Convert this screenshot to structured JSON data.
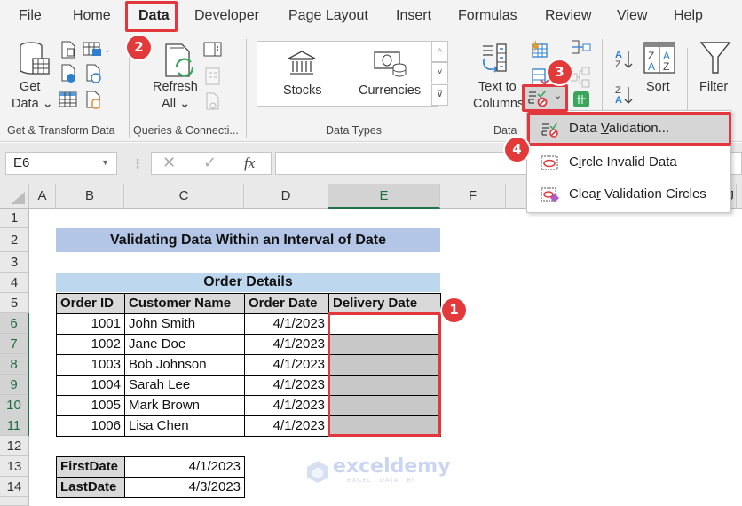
{
  "tabs": [
    {
      "label": "File",
      "active": false
    },
    {
      "label": "Home",
      "active": false
    },
    {
      "label": "Data",
      "active": true
    },
    {
      "label": "Developer",
      "active": false
    },
    {
      "label": "Page Layout",
      "active": false
    },
    {
      "label": "Insert",
      "active": false
    },
    {
      "label": "Formulas",
      "active": false
    },
    {
      "label": "Review",
      "active": false
    },
    {
      "label": "View",
      "active": false
    },
    {
      "label": "Help",
      "active": false
    }
  ],
  "ribbon": {
    "get_data": {
      "line1": "Get",
      "line2": "Data ⌄"
    },
    "refresh_all": {
      "line1": "Refresh",
      "line2": "All ⌄"
    },
    "stocks": "Stocks",
    "currencies": "Currencies",
    "text_to_columns": {
      "line1": "Text to",
      "line2": "Columns"
    },
    "sort": "Sort",
    "filter": "Filter",
    "groups": {
      "get_transform": "Get & Transform Data",
      "queries": "Queries & Connecti...",
      "data_types": "Data Types",
      "data_tools": "Data"
    }
  },
  "dropdown": {
    "items": [
      {
        "pre": "Data ",
        "u": "V",
        "post": "alidation...",
        "highlighted": true
      },
      {
        "pre": "C",
        "u": "i",
        "post": "rcle Invalid Data",
        "highlighted": false
      },
      {
        "pre": "Clea",
        "u": "r",
        "post": " Validation Circles",
        "highlighted": false
      }
    ]
  },
  "formula_bar": {
    "name_box": "E6",
    "fx": "fx",
    "value": ""
  },
  "columns": [
    "A",
    "B",
    "C",
    "D",
    "E",
    "F",
    "J"
  ],
  "rows": [
    "1",
    "2",
    "3",
    "4",
    "5",
    "6",
    "7",
    "8",
    "9",
    "10",
    "11",
    "12",
    "13",
    "14"
  ],
  "sheet": {
    "title": "Validating Data Within an Interval of Date",
    "table_title": "Order Details",
    "headers": [
      "Order ID",
      "Customer Name",
      "Order Date",
      "Delivery Date"
    ],
    "rows": [
      {
        "id": "1001",
        "name": "John Smith",
        "order_date": "4/1/2023",
        "delivery": ""
      },
      {
        "id": "1002",
        "name": "Jane Doe",
        "order_date": "4/1/2023",
        "delivery": ""
      },
      {
        "id": "1003",
        "name": "Bob Johnson",
        "order_date": "4/1/2023",
        "delivery": ""
      },
      {
        "id": "1004",
        "name": "Sarah Lee",
        "order_date": "4/1/2023",
        "delivery": ""
      },
      {
        "id": "1005",
        "name": "Mark Brown",
        "order_date": "4/1/2023",
        "delivery": ""
      },
      {
        "id": "1006",
        "name": "Lisa Chen",
        "order_date": "4/1/2023",
        "delivery": ""
      }
    ],
    "params": [
      {
        "label": "FirstDate",
        "value": "4/1/2023"
      },
      {
        "label": "LastDate",
        "value": "4/3/2023"
      }
    ]
  },
  "annotations": [
    "1",
    "2",
    "3",
    "4"
  ],
  "watermark": {
    "name": "exceldemy",
    "tagline": "EXCEL · DATA · BI"
  },
  "colors": {
    "accent": "#217346",
    "highlight": "#e2373d",
    "title_fill": "#b4c6e7",
    "table_title_fill": "#bdd7ee",
    "header_fill": "#d9d9d9",
    "selection_fill": "#c8c8c8"
  }
}
